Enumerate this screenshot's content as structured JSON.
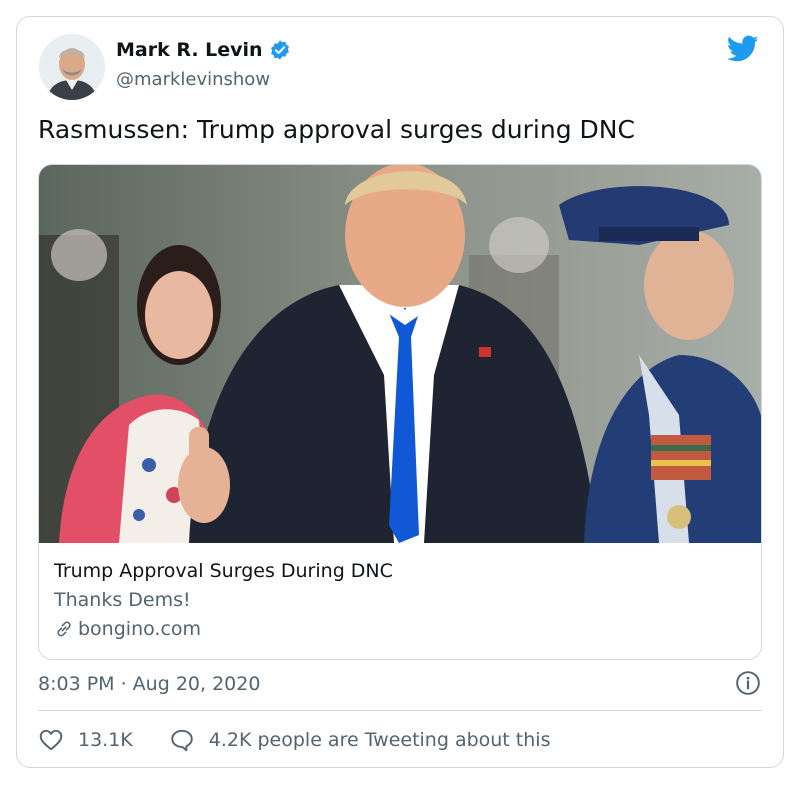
{
  "author": {
    "name": "Mark R. Levin",
    "handle": "@marklevinshow"
  },
  "tweet": {
    "text": "Rasmussen: Trump approval surges during DNC",
    "timestamp": "8:03 PM · Aug 20, 2020"
  },
  "link_card": {
    "title": "Trump Approval Surges During DNC",
    "description": "Thanks Dems!",
    "domain": "bongino.com"
  },
  "stats": {
    "likes": "13.1K",
    "conversation": "4.2K people are Tweeting about this"
  },
  "icons": {
    "verified": "verified-badge-icon",
    "logo": "twitter-bird-icon",
    "link": "link-icon",
    "info": "info-icon",
    "like": "heart-icon",
    "reply": "speech-bubble-icon"
  },
  "colors": {
    "accent": "#1d9bf0",
    "text_primary": "#0f1419",
    "text_secondary": "#536471",
    "border": "#cfd9de"
  }
}
